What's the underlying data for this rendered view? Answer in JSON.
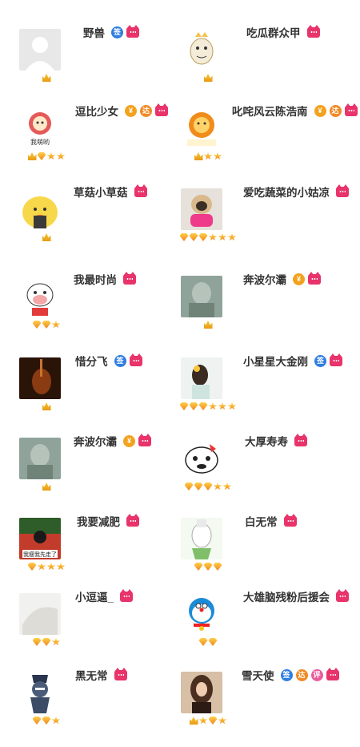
{
  "colors": {
    "name_text": "#333333",
    "badge_sign": "#2f7de1",
    "badge_yen": "#f3a21e",
    "badge_da": "#f08a24",
    "badge_ping": "#ea5d9c",
    "badge_cat": "#e8336b",
    "medal_gold": "#f2a41c"
  },
  "users": [
    {
      "name": "野兽",
      "avatar": "default-avatar",
      "badges": [
        {
          "type": "sign",
          "label": "签"
        },
        {
          "type": "cat",
          "label": ""
        }
      ],
      "medals": [
        "crown"
      ]
    },
    {
      "name": "吃瓜群众甲",
      "avatar": "cartoon-avatar",
      "badges": [
        {
          "type": "cat",
          "label": ""
        }
      ],
      "medals": [
        "crown"
      ]
    },
    {
      "name": "逗比少女",
      "avatar": "flower-avatar",
      "badges": [
        {
          "type": "yen",
          "label": "¥"
        },
        {
          "type": "da",
          "label": "达"
        },
        {
          "type": "cat",
          "label": ""
        }
      ],
      "medals": [
        "crown",
        "diamond",
        "star",
        "star"
      ]
    },
    {
      "name": "叱咤风云陈浩南",
      "avatar": "lion-avatar",
      "badges": [
        {
          "type": "yen",
          "label": "¥"
        },
        {
          "type": "da",
          "label": "达"
        },
        {
          "type": "cat",
          "label": ""
        }
      ],
      "medals": [
        "crown",
        "star",
        "star"
      ]
    },
    {
      "name": "草菇小草菇",
      "avatar": "chick-avatar",
      "badges": [
        {
          "type": "cat",
          "label": ""
        }
      ],
      "medals": [
        "crown"
      ]
    },
    {
      "name": "爱吃蔬菜的小姑凉",
      "avatar": "dog-photo",
      "badges": [
        {
          "type": "cat",
          "label": ""
        }
      ],
      "medals": [
        "diamond",
        "diamond",
        "diamond",
        "star",
        "star",
        "star"
      ]
    },
    {
      "name": "我最时尚",
      "avatar": "cow-avatar",
      "badges": [
        {
          "type": "cat",
          "label": ""
        }
      ],
      "medals": [
        "diamond",
        "diamond",
        "star"
      ]
    },
    {
      "name": "奔波尔灞",
      "avatar": "statue-photo",
      "badges": [
        {
          "type": "yen",
          "label": "¥"
        },
        {
          "type": "cat",
          "label": ""
        }
      ],
      "medals": [
        "crown"
      ]
    },
    {
      "name": "惜分飞",
      "avatar": "violin-photo",
      "badges": [
        {
          "type": "sign",
          "label": "签"
        },
        {
          "type": "cat",
          "label": ""
        }
      ],
      "medals": [
        "crown"
      ]
    },
    {
      "name": "小星星大金刚",
      "avatar": "girl-photo",
      "badges": [
        {
          "type": "sign",
          "label": "签"
        },
        {
          "type": "cat",
          "label": ""
        }
      ],
      "medals": [
        "diamond",
        "diamond",
        "diamond",
        "star",
        "star",
        "star"
      ]
    },
    {
      "name": "奔波尔灞",
      "avatar": "statue-photo",
      "badges": [
        {
          "type": "yen",
          "label": "¥"
        },
        {
          "type": "cat",
          "label": ""
        }
      ],
      "medals": [
        "crown"
      ]
    },
    {
      "name": "大厚寿寿",
      "avatar": "kitty-avatar",
      "badges": [
        {
          "type": "cat",
          "label": ""
        }
      ],
      "medals": [
        "diamond",
        "diamond",
        "diamond",
        "star",
        "star"
      ]
    },
    {
      "name": "我要减肥",
      "avatar": "meme-photo",
      "badges": [
        {
          "type": "cat",
          "label": ""
        }
      ],
      "medals": [
        "diamond",
        "star",
        "star",
        "star"
      ]
    },
    {
      "name": "白无常",
      "avatar": "ghost-avatar",
      "badges": [
        {
          "type": "cat",
          "label": ""
        }
      ],
      "medals": [
        "diamond",
        "diamond",
        "diamond"
      ]
    },
    {
      "name": "小逗逼_",
      "avatar": "cloth-photo",
      "badges": [
        {
          "type": "cat",
          "label": ""
        }
      ],
      "medals": [
        "diamond",
        "diamond",
        "star"
      ]
    },
    {
      "name": "大雄脑残粉后援会",
      "avatar": "doraemon-avatar",
      "badges": [
        {
          "type": "cat",
          "label": ""
        }
      ],
      "medals": [
        "diamond",
        "diamond"
      ]
    },
    {
      "name": "黑无常",
      "avatar": "black-ghost-avatar",
      "badges": [
        {
          "type": "cat",
          "label": ""
        }
      ],
      "medals": [
        "diamond",
        "diamond",
        "star"
      ]
    },
    {
      "name": "雪天使",
      "avatar": "woman-photo",
      "badges": [
        {
          "type": "sign",
          "label": "签"
        },
        {
          "type": "da",
          "label": "达"
        },
        {
          "type": "ping",
          "label": "评"
        },
        {
          "type": "cat",
          "label": ""
        }
      ],
      "medals": [
        "crown",
        "star",
        "diamond",
        "star"
      ]
    }
  ]
}
